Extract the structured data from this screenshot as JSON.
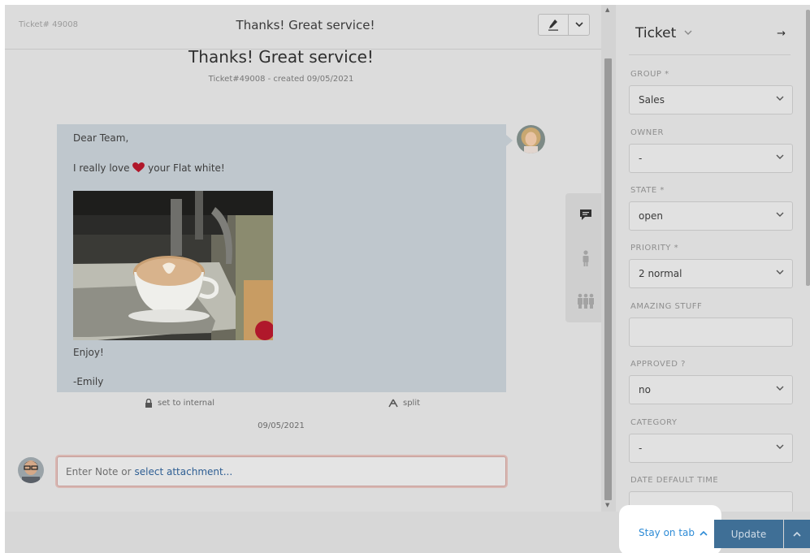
{
  "header": {
    "ticket_number": "Ticket# 49008",
    "title": "Thanks! Great service!",
    "signature_icon": "pen-icon",
    "dropdown_icon": "chevron-down-icon"
  },
  "ticket": {
    "title": "Thanks! Great service!",
    "subtitle": "Ticket#49008 - created 09/05/2021"
  },
  "article": {
    "greeting": "Dear Team,",
    "line_before_heart": "I really love",
    "line_after_heart": "your Flat white!",
    "closing": "Enjoy!",
    "signature": "-Emily",
    "image_alt": "coffee-photo",
    "actions": {
      "internal": "set to internal",
      "split": "split"
    },
    "date": "09/05/2021"
  },
  "note": {
    "placeholder": "Enter Note or",
    "attachment_link": "select attachment..."
  },
  "side_tabs": [
    "chat-icon",
    "customer-icon",
    "organization-icon"
  ],
  "sidebar": {
    "title": "Ticket",
    "fields": [
      {
        "label": "GROUP *",
        "value": "Sales",
        "type": "select"
      },
      {
        "label": "OWNER",
        "value": "-",
        "type": "select"
      },
      {
        "label": "STATE *",
        "value": "open",
        "type": "select"
      },
      {
        "label": "PRIORITY *",
        "value": "2 normal",
        "type": "select"
      },
      {
        "label": "AMAZING STUFF",
        "value": "",
        "type": "text"
      },
      {
        "label": "APPROVED ?",
        "value": "no",
        "type": "select"
      },
      {
        "label": "CATEGORY",
        "value": "-",
        "type": "select"
      },
      {
        "label": "DATE DEFAULT TIME",
        "value": "",
        "type": "text"
      }
    ]
  },
  "footer": {
    "stay_on_tab": "Stay on tab",
    "update": "Update"
  },
  "colors": {
    "accent": "#2d8bd6",
    "update_button": "#3f6f96",
    "heart": "#b0172a"
  }
}
